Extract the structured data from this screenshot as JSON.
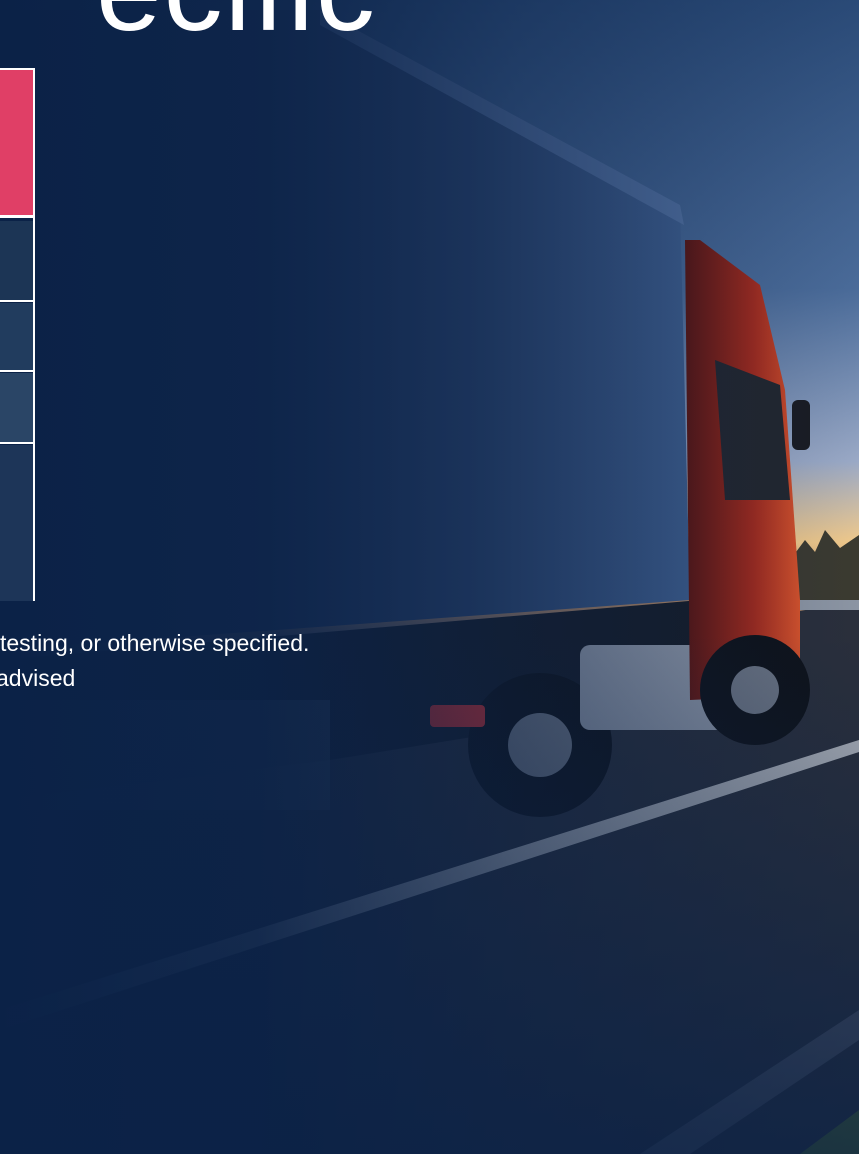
{
  "heading": {
    "text": "ecific"
  },
  "spec_table": {
    "rows": [
      "",
      "",
      "",
      "",
      ""
    ],
    "highlight_color": "#e03f66",
    "row_color": "#1c3555"
  },
  "notes": {
    "line1": "testing, or otherwise specified.",
    "line2": "advised"
  },
  "background": {
    "subject": "red-cab truck with blue trailer on highway at sunset",
    "overlay_color": "#0b2247"
  }
}
